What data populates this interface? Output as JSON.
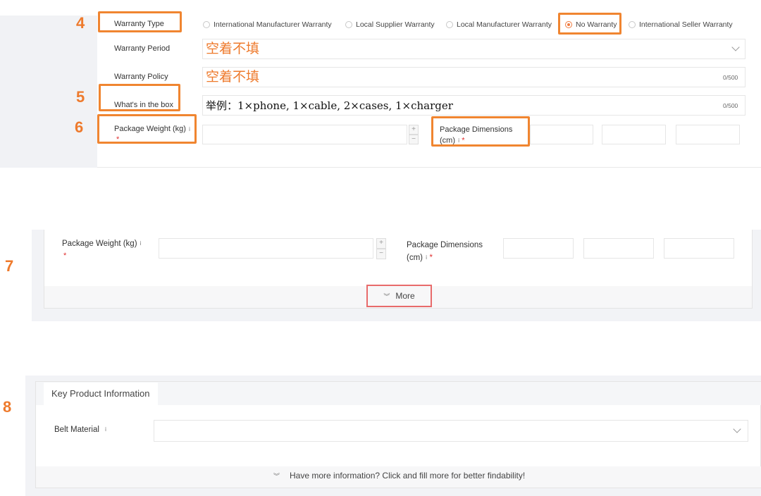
{
  "steps": {
    "s4": "4",
    "s5": "5",
    "s6": "6",
    "s7": "7",
    "s8": "8"
  },
  "panel1": {
    "warranty_type_label": "Warranty Type",
    "warranty_options": [
      "International Manufacturer Warranty",
      "Local Supplier Warranty",
      "Local Manufacturer Warranty",
      "No Warranty",
      "International Seller Warranty"
    ],
    "selected_option": "No Warranty",
    "warranty_period_label": "Warranty Period",
    "warranty_period_note": "空着不填",
    "warranty_policy_label": "Warranty Policy",
    "warranty_policy_note": "空着不填",
    "warranty_policy_counter": "0/500",
    "whats_in_box_label": "What's in the box",
    "whats_in_box_note": "举例：1×phone, 1×cable, 2×cases, 1×charger",
    "whats_in_box_counter": "0/500",
    "package_weight_label": "Package Weight (kg)",
    "package_dimensions_label_line1": "Package Dimensions",
    "package_dimensions_label_line2": "(cm)",
    "required_mark": "*",
    "info_mark": "i",
    "plus": "+",
    "minus": "−"
  },
  "panel2": {
    "package_weight_label": "Package Weight (kg)",
    "package_dimensions_label_line1": "Package Dimensions",
    "package_dimensions_label_line2": "(cm)",
    "more_label": "More"
  },
  "panel3": {
    "section_title": "Key Product Information",
    "belt_material_label": "Belt Material",
    "more_info_label": "Have more information? Click and fill more for better findability!"
  },
  "colors": {
    "accent_orange": "#f08530",
    "radio_selected": "#f07b3f",
    "required": "#e03030",
    "frame_red": "#e86b6b"
  }
}
